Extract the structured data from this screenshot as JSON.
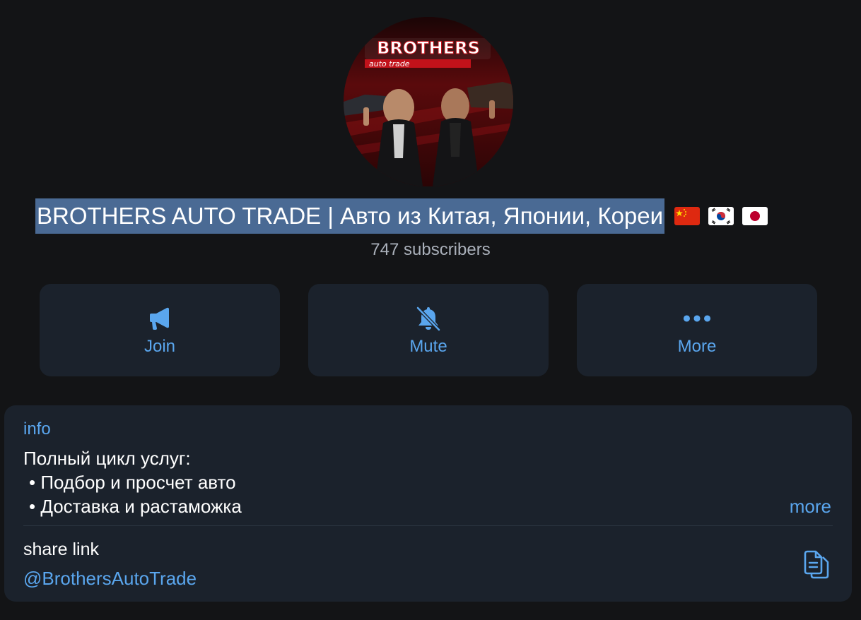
{
  "channel": {
    "title": "BROTHERS AUTO TRADE | Авто из Китая, Японии, Кореи",
    "flags": [
      "china-flag",
      "south-korea-flag",
      "japan-flag"
    ],
    "subscribers": "747 subscribers",
    "avatar_logo": {
      "brand": "BROTHERS",
      "tagline": "auto trade"
    }
  },
  "actions": [
    {
      "label": "Join",
      "icon": "megaphone-icon"
    },
    {
      "label": "Mute",
      "icon": "bell-slash-icon"
    },
    {
      "label": "More",
      "icon": "ellipsis-icon"
    }
  ],
  "info": {
    "header": "info",
    "lines": [
      "Полный цикл услуг:",
      "• Подбор и просчет авто",
      "• Доставка и растаможка"
    ],
    "more_label": "more"
  },
  "share": {
    "label": "share link",
    "handle": "@BrothersAutoTrade",
    "icon": "copy-icon"
  },
  "colors": {
    "background": "#131416",
    "card": "#1b222c",
    "accent": "#5aa6ee",
    "selection": "#4a6a94",
    "muted_text": "#aab0ba"
  }
}
